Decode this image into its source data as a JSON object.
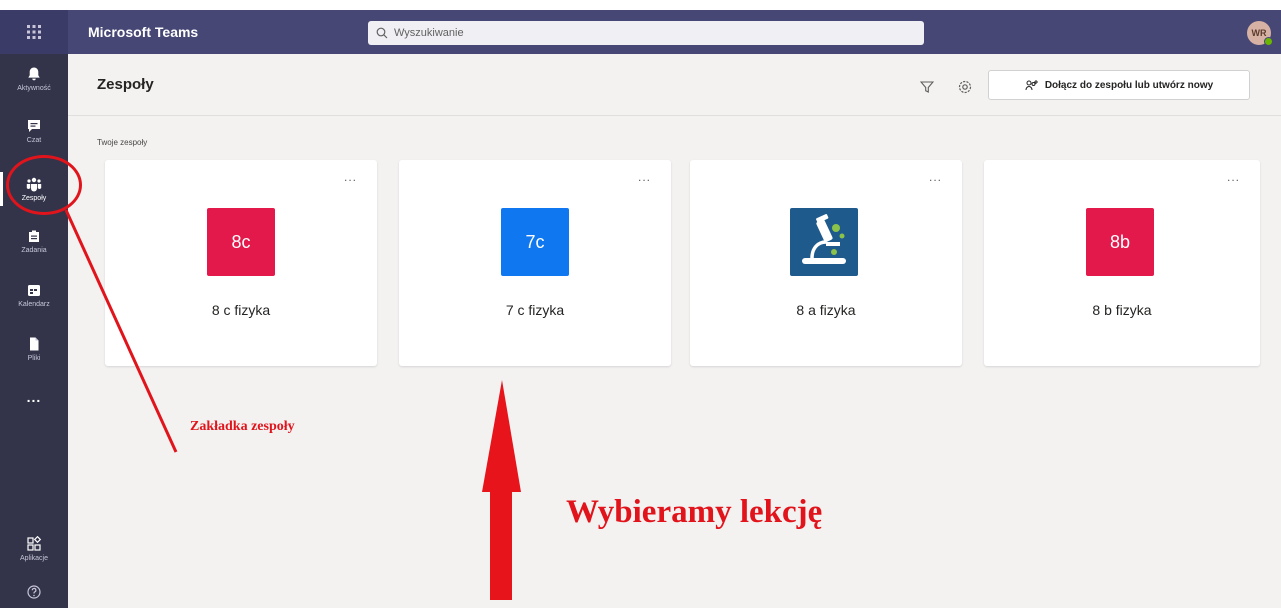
{
  "app": {
    "title": "Microsoft Teams",
    "search_placeholder": "Wyszukiwanie",
    "avatar_initials": "WR"
  },
  "rail": {
    "items": [
      {
        "label": "Aktywność",
        "icon": "bell-icon"
      },
      {
        "label": "Czat",
        "icon": "chat-icon"
      },
      {
        "label": "Zespoły",
        "icon": "teams-icon"
      },
      {
        "label": "Zadania",
        "icon": "assignments-icon"
      },
      {
        "label": "Kalendarz",
        "icon": "calendar-icon"
      },
      {
        "label": "Pliki",
        "icon": "files-icon"
      },
      {
        "label": "...",
        "icon": "more-icon"
      },
      {
        "label": "Aplikacje",
        "icon": "apps-icon"
      },
      {
        "label": "",
        "icon": "help-icon"
      }
    ]
  },
  "header": {
    "title": "Zespoły",
    "join_button": "Dołącz do zespołu lub utwórz nowy"
  },
  "section": {
    "label": "Twoje zespoły"
  },
  "teams": [
    {
      "tile": "8c",
      "name": "8 c fizyka",
      "color": "#e3194b"
    },
    {
      "tile": "7c",
      "name": "7 c fizyka",
      "color": "#0f78f0"
    },
    {
      "tile": "",
      "name": "8 a fizyka",
      "color": "#1f5a8c",
      "icon": "microscope-icon"
    },
    {
      "tile": "8b",
      "name": "8 b fizyka",
      "color": "#e3194b"
    }
  ],
  "more_menu": "...",
  "annotations": {
    "tab_label": "Zakładka zespoły",
    "choose_lesson": "Wybieramy lekcję",
    "color": "#e1141c"
  }
}
